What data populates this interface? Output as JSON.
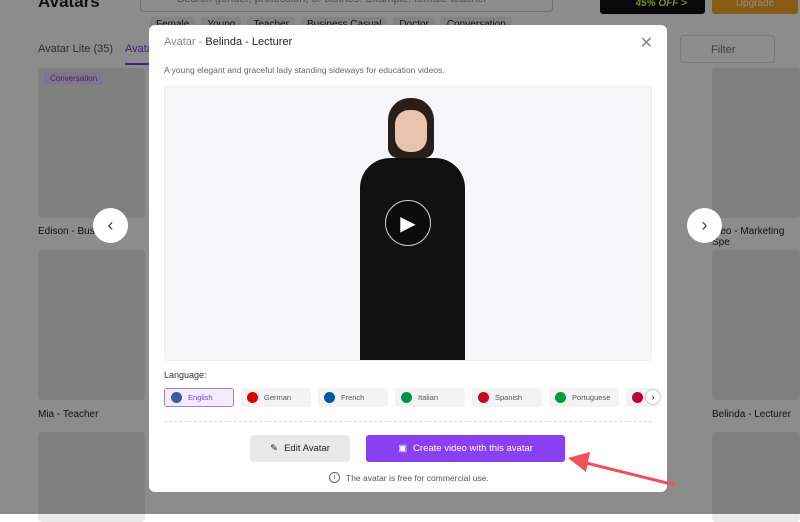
{
  "background": {
    "title": "Avatars",
    "search_placeholder": "Search gender, profession, or clothes. Example: female teacher",
    "tags": [
      "Female",
      "Young",
      "Teacher",
      "Business Casual",
      "Doctor",
      "Conversation"
    ],
    "promo": "45% OFF >",
    "upgrade": "Upgrade",
    "tabs": [
      "Avatar Lite (35)",
      "Avatar"
    ],
    "filter": "Filter",
    "badge": "Conversation",
    "cards": [
      "Edison - Busin",
      "Mia - Teacher",
      "ateo - Marketing Spe",
      "Belinda - Lecturer"
    ]
  },
  "modal": {
    "prefix": "Avatar -",
    "name": "Belinda - Lecturer",
    "description": "A young elegant and graceful lady standing sideways for education videos.",
    "language_label": "Language:",
    "languages": [
      {
        "label": "English",
        "flag": "#3c5aa6"
      },
      {
        "label": "German",
        "flag": "#dd0000"
      },
      {
        "label": "French",
        "flag": "#0055a4"
      },
      {
        "label": "Italian",
        "flag": "#009246"
      },
      {
        "label": "Spanish",
        "flag": "#c60b1e"
      },
      {
        "label": "Portuguese",
        "flag": "#009c3b"
      },
      {
        "label": "",
        "flag": "#bc002d"
      }
    ],
    "selected_language": "English",
    "edit_label": "Edit Avatar",
    "create_label": "Create video with this avatar",
    "note": "The avatar is free for commercial use.",
    "accent": "#8a3ff0"
  }
}
